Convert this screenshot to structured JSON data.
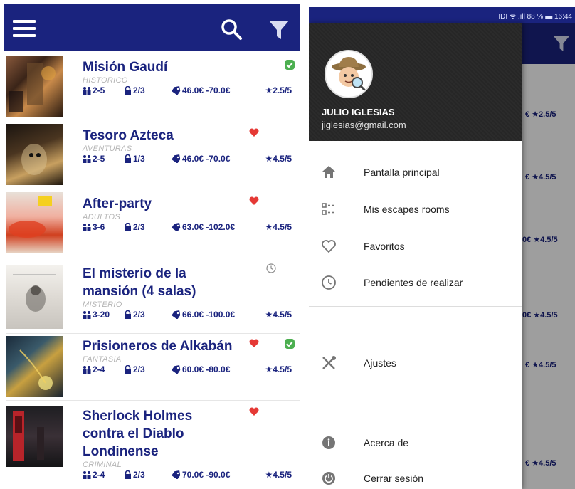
{
  "left_screen": {
    "appbar": {
      "menu_icon": "hamburger-icon",
      "search_icon": "search-icon",
      "filter_icon": "filter-icon",
      "color": "#1a237e"
    },
    "rooms": [
      {
        "title_lines": [
          "Misión Gaudí"
        ],
        "category": "HISTORICO",
        "players": "2-5",
        "difficulty": "2/3",
        "price": "46.0€ -70.0€",
        "rating": "2.5/5",
        "badges": [
          "check-badge-icon"
        ]
      },
      {
        "title_lines": [
          "Tesoro Azteca"
        ],
        "category": "AVENTURAS",
        "players": "2-5",
        "difficulty": "1/3",
        "price": "46.0€ -70.0€",
        "rating": "4.5/5",
        "badges": [
          "heart-icon"
        ]
      },
      {
        "title_lines": [
          "After-party"
        ],
        "category": "ADULTOS",
        "players": "3-6",
        "difficulty": "2/3",
        "price": "63.0€ -102.0€",
        "rating": "4.5/5",
        "badges": [
          "heart-icon"
        ]
      },
      {
        "title_lines": [
          "El misterio de la",
          "mansión (4 salas)"
        ],
        "category": "MISTERIO",
        "players": "3-20",
        "difficulty": "2/3",
        "price": "66.0€ -100.0€",
        "rating": "4.5/5",
        "badges": [
          "clock-badge-icon"
        ]
      },
      {
        "title_lines": [
          "Prisioneros de Alkabán"
        ],
        "category": "FANTASIA",
        "players": "2-4",
        "difficulty": "2/3",
        "price": "60.0€ -80.0€",
        "rating": "4.5/5",
        "badges": [
          "heart-icon",
          "check-badge-icon"
        ]
      },
      {
        "title_lines": [
          "Sherlock Holmes",
          "contra el Diablo",
          "Londinense"
        ],
        "category": "CRIMINAL",
        "players": "2-4",
        "difficulty": "2/3",
        "price": "70.0€ -90.0€",
        "rating": "4.5/5",
        "badges": [
          "heart-icon"
        ]
      }
    ]
  },
  "right_screen": {
    "status_bar": "IDI ᯤ .ıll 88 % ▬ 16:44",
    "user": {
      "name": "JULIO IGLESIAS",
      "email": "jiglesias@gmail.com"
    },
    "menu": [
      {
        "label": "Pantalla principal",
        "icon": "home-icon"
      },
      {
        "label": "Mis escapes rooms",
        "icon": "list-icon"
      },
      {
        "label": "Favoritos",
        "icon": "heart-outline-icon"
      },
      {
        "label": "Pendientes de realizar",
        "icon": "clock-icon"
      },
      {
        "label": "Ajustes",
        "icon": "settings-tools-icon"
      },
      {
        "label": "Acerca de",
        "icon": "info-icon"
      },
      {
        "label": "Cerrar sesión",
        "icon": "power-icon"
      }
    ],
    "background_rows": [
      "€ ★2.5/5",
      "€ ★4.5/5",
      "0€ ★4.5/5",
      "0€ ★4.5/5",
      "€ ★4.5/5",
      "€ ★4.5/5"
    ]
  }
}
